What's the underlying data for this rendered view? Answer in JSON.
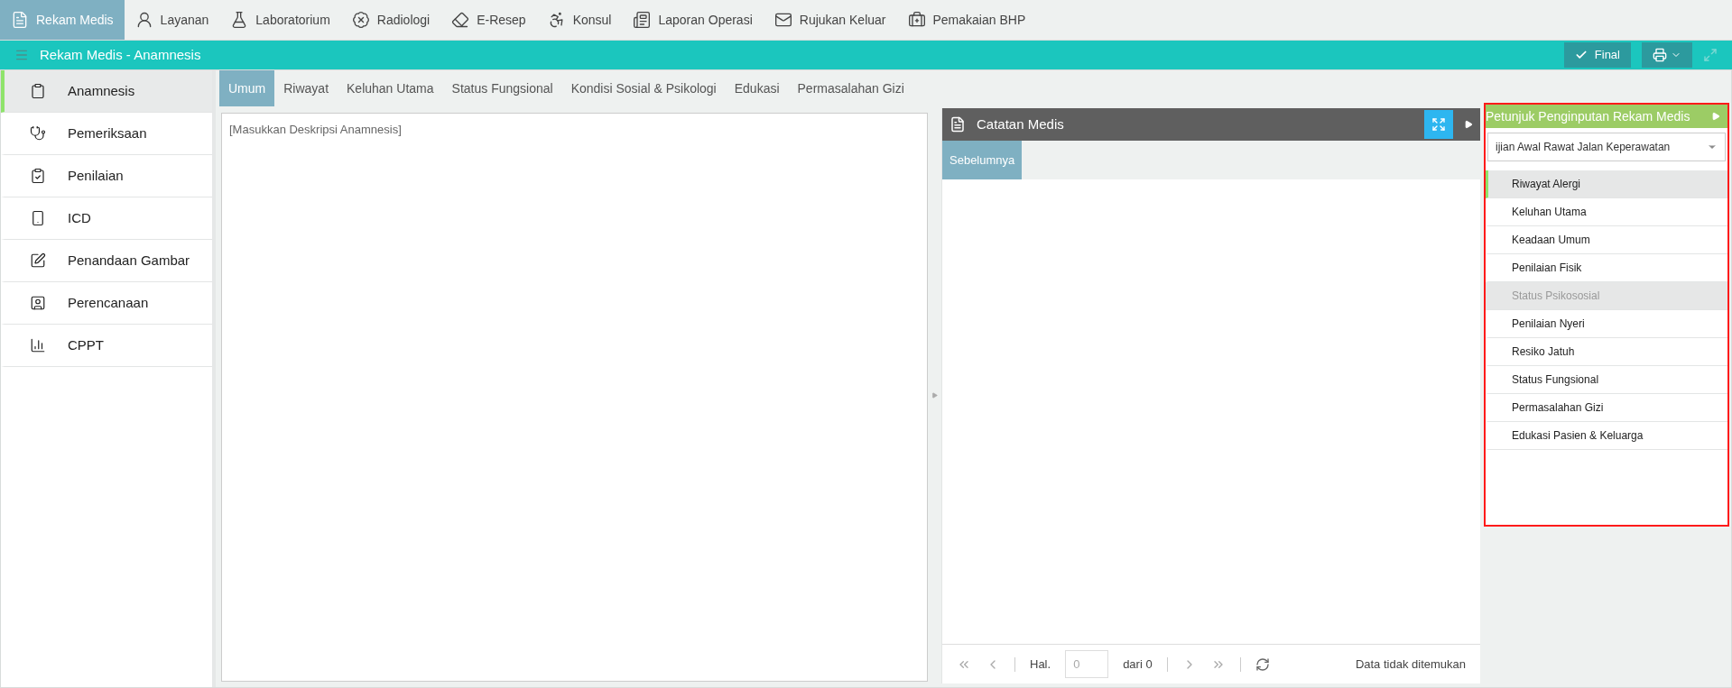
{
  "top_menu": [
    {
      "label": "Rekam Medis",
      "selected": true
    },
    {
      "label": "Layanan",
      "selected": false
    },
    {
      "label": "Laboratorium",
      "selected": false
    },
    {
      "label": "Radiologi",
      "selected": false
    },
    {
      "label": "E-Resep",
      "selected": false
    },
    {
      "label": "Konsul",
      "selected": false
    },
    {
      "label": "Laporan Operasi",
      "selected": false
    },
    {
      "label": "Rujukan Keluar",
      "selected": false
    },
    {
      "label": "Pemakaian BHP",
      "selected": false
    }
  ],
  "title_bar": {
    "title": "Rekam Medis - Anamnesis",
    "final_button": "Final"
  },
  "sidebar": {
    "items": [
      {
        "label": "Anamnesis",
        "selected": true
      },
      {
        "label": "Pemeriksaan",
        "selected": false
      },
      {
        "label": "Penilaian",
        "selected": false
      },
      {
        "label": "ICD",
        "selected": false
      },
      {
        "label": "Penandaan Gambar",
        "selected": false
      },
      {
        "label": "Perencanaan",
        "selected": false
      },
      {
        "label": "CPPT",
        "selected": false
      }
    ]
  },
  "tabs": [
    {
      "label": "Umum",
      "selected": true
    },
    {
      "label": "Riwayat",
      "selected": false
    },
    {
      "label": "Keluhan Utama",
      "selected": false
    },
    {
      "label": "Status Fungsional",
      "selected": false
    },
    {
      "label": "Kondisi Sosial & Psikologi",
      "selected": false
    },
    {
      "label": "Edukasi",
      "selected": false
    },
    {
      "label": "Permasalahan Gizi",
      "selected": false
    }
  ],
  "editor": {
    "placeholder": "[Masukkan Deskripsi Anamnesis]"
  },
  "catatan_medis": {
    "title": "Catatan Medis",
    "tabs": [
      {
        "label": "Sebelumnya",
        "selected": true
      }
    ],
    "pager": {
      "page_label": "Hal.",
      "page_value": "0",
      "of_label": "dari 0",
      "status": "Data tidak ditemukan"
    }
  },
  "petunjuk": {
    "title": "Petunjuk Penginputan Rekam Medis",
    "dropdown_value": "ijian Awal Rawat Jalan Keperawatan",
    "items": [
      {
        "label": "Riwayat Alergi",
        "selected": true,
        "disabled": false
      },
      {
        "label": "Keluhan Utama",
        "selected": false,
        "disabled": false
      },
      {
        "label": "Keadaan Umum",
        "selected": false,
        "disabled": false
      },
      {
        "label": "Penilaian Fisik",
        "selected": false,
        "disabled": false
      },
      {
        "label": "Status Psikososial",
        "selected": false,
        "disabled": true
      },
      {
        "label": "Penilaian Nyeri",
        "selected": false,
        "disabled": false
      },
      {
        "label": "Resiko Jatuh",
        "selected": false,
        "disabled": false
      },
      {
        "label": "Status Fungsional",
        "selected": false,
        "disabled": false
      },
      {
        "label": "Permasalahan Gizi",
        "selected": false,
        "disabled": false
      },
      {
        "label": "Edukasi Pasien & Keluarga",
        "selected": false,
        "disabled": false
      }
    ]
  }
}
